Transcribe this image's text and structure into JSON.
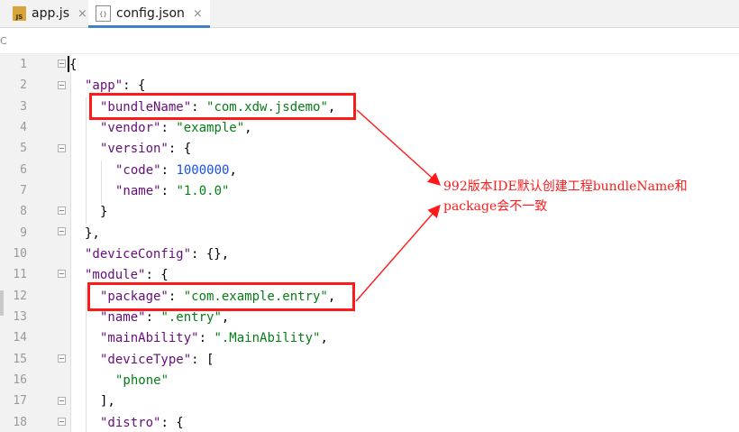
{
  "tabs": [
    {
      "label": "app.js",
      "icon": "js-file-icon",
      "icon_text": "JS",
      "active": false
    },
    {
      "label": "config.json",
      "icon": "json-file-icon",
      "icon_text": "{}",
      "active": true
    }
  ],
  "close_glyph": "×",
  "strip_mark": "C",
  "line_numbers": [
    "1",
    "2",
    "3",
    "4",
    "5",
    "6",
    "7",
    "8",
    "9",
    "10",
    "11",
    "12",
    "13",
    "14",
    "15",
    "16",
    "17",
    "18"
  ],
  "code": {
    "l1": {
      "p1": "{"
    },
    "l2": {
      "k": "\"app\"",
      "p": ": {"
    },
    "l3": {
      "k": "\"bundleName\"",
      "p": ": ",
      "s": "\"com.xdw.jsdemo\"",
      "p2": ","
    },
    "l4": {
      "k": "\"vendor\"",
      "p": ": ",
      "s": "\"example\"",
      "p2": ","
    },
    "l5": {
      "k": "\"version\"",
      "p": ": {"
    },
    "l6": {
      "k": "\"code\"",
      "p": ": ",
      "n": "1000000",
      "p2": ","
    },
    "l7": {
      "k": "\"name\"",
      "p": ": ",
      "s": "\"1.0.0\""
    },
    "l8": {
      "p": "}"
    },
    "l9": {
      "p": "},"
    },
    "l10": {
      "k": "\"deviceConfig\"",
      "p": ": {},"
    },
    "l11": {
      "k": "\"module\"",
      "p": ": {"
    },
    "l12": {
      "k": "\"package\"",
      "p": ": ",
      "s": "\"com.example.entry\"",
      "p2": ","
    },
    "l13": {
      "k": "\"name\"",
      "p": ": ",
      "s": "\".entry\"",
      "p2": ","
    },
    "l14": {
      "k": "\"mainAbility\"",
      "p": ": ",
      "s": "\".MainAbility\"",
      "p2": ","
    },
    "l15": {
      "k": "\"deviceType\"",
      "p": ": ["
    },
    "l16": {
      "s": "\"phone\""
    },
    "l17": {
      "p": "],"
    },
    "l18": {
      "k": "\"distro\"",
      "p": ": {"
    }
  },
  "annotation": {
    "line1": "992版本IDE默认创建工程bundleName和",
    "line2": "package会不一致",
    "color": "#ff1a1a"
  },
  "colors": {
    "key": "#660e7a",
    "string": "#067d17",
    "number": "#1750eb",
    "tab_accent": "#4083c9"
  }
}
